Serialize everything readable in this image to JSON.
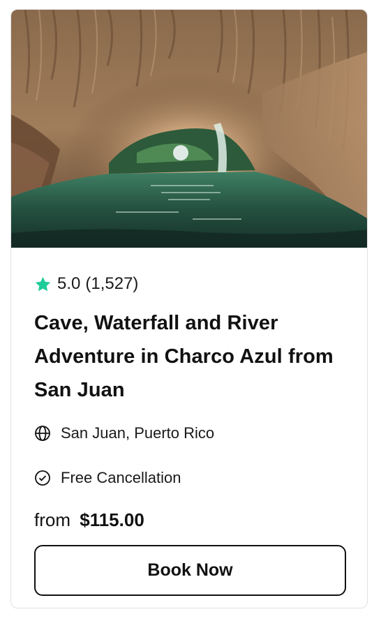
{
  "card": {
    "image_alt": "Cave with waterfall and river",
    "rating": {
      "score": "5.0",
      "count": "(1,527)",
      "star_color": "#1fcc9a"
    },
    "title": "Cave, Waterfall and River Adventure in Charco Azul from San Juan",
    "location": {
      "icon": "globe-icon",
      "text": "San Juan, Puerto Rico"
    },
    "cancellation": {
      "icon": "check-circle-icon",
      "text": "Free Cancellation"
    },
    "price": {
      "prefix": "from",
      "amount": "$115.00"
    },
    "book_button_label": "Book Now"
  }
}
